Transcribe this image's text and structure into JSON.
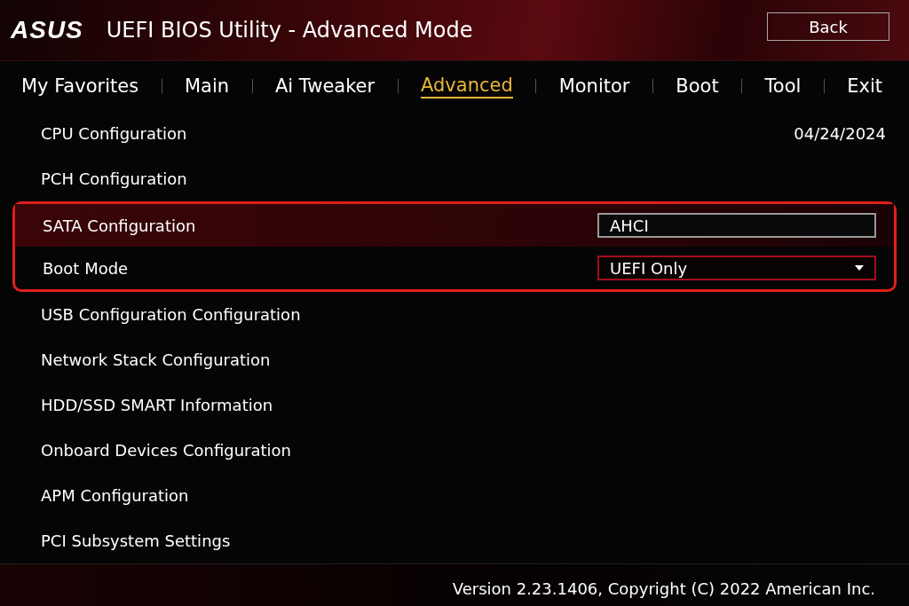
{
  "header": {
    "logo": "ASUS",
    "title": "UEFI BIOS Utility - Advanced Mode",
    "back_button": "Back"
  },
  "tabs": [
    {
      "label": "My Favorites",
      "selected": false
    },
    {
      "label": "Main",
      "selected": false
    },
    {
      "label": "Ai Tweaker",
      "selected": false
    },
    {
      "label": "Advanced",
      "selected": true
    },
    {
      "label": "Monitor",
      "selected": false
    },
    {
      "label": "Boot",
      "selected": false
    },
    {
      "label": "Tool",
      "selected": false
    },
    {
      "label": "Exit",
      "selected": false
    }
  ],
  "date": "04/24/2024",
  "items": [
    {
      "kind": "link",
      "label": "CPU Configuration",
      "boxed": false,
      "selected": false
    },
    {
      "kind": "link",
      "label": "PCH Configuration",
      "boxed": false,
      "selected": false
    },
    {
      "kind": "field",
      "label": "SATA Configuration",
      "value": "AHCI",
      "boxed": true,
      "selected": true
    },
    {
      "kind": "dropdown",
      "label": "Boot Mode",
      "value": "UEFI Only",
      "boxed": true,
      "selected": false
    },
    {
      "kind": "link",
      "label": "USB Configuration Configuration",
      "boxed": false,
      "selected": false
    },
    {
      "kind": "link",
      "label": "Network Stack Configuration",
      "boxed": false,
      "selected": false
    },
    {
      "kind": "link",
      "label": "HDD/SSD SMART Information",
      "boxed": false,
      "selected": false
    },
    {
      "kind": "link",
      "label": "Onboard Devices Configuration",
      "boxed": false,
      "selected": false
    },
    {
      "kind": "link",
      "label": "APM Configuration",
      "boxed": false,
      "selected": false
    },
    {
      "kind": "link",
      "label": "PCI Subsystem Settings",
      "boxed": false,
      "selected": false
    }
  ],
  "footer": "Version 2.23.1406, Copyright (C) 2022 American Inc."
}
